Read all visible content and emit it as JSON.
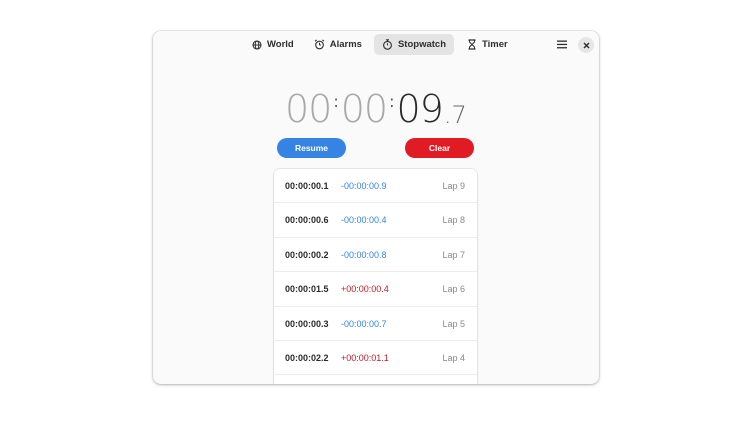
{
  "tabs": [
    {
      "label": "World",
      "icon": "globe-icon",
      "active": false
    },
    {
      "label": "Alarms",
      "icon": "alarm-clock-icon",
      "active": false
    },
    {
      "label": "Stopwatch",
      "icon": "stopwatch-icon",
      "active": true
    },
    {
      "label": "Timer",
      "icon": "hourglass-icon",
      "active": false
    }
  ],
  "header": {
    "menu_icon": "hamburger-menu-icon",
    "close_icon": "close-icon"
  },
  "clock": {
    "hours": "00",
    "sep1": ":",
    "minutes": "00",
    "sep2": ":",
    "seconds": "09",
    "fraction": ".7"
  },
  "buttons": {
    "resume_label": "Resume",
    "clear_label": "Clear"
  },
  "laps": [
    {
      "time": "00:00:00.1",
      "delta": "-00:00:00.9",
      "sign": "neg",
      "name": "Lap 9"
    },
    {
      "time": "00:00:00.6",
      "delta": "-00:00:00.4",
      "sign": "neg",
      "name": "Lap 8"
    },
    {
      "time": "00:00:00.2",
      "delta": "-00:00:00.8",
      "sign": "neg",
      "name": "Lap 7"
    },
    {
      "time": "00:00:01.5",
      "delta": "+00:00:00.4",
      "sign": "pos",
      "name": "Lap 6"
    },
    {
      "time": "00:00:00.3",
      "delta": "-00:00:00.7",
      "sign": "neg",
      "name": "Lap 5"
    },
    {
      "time": "00:00:02.2",
      "delta": "+00:00:01.1",
      "sign": "pos",
      "name": "Lap 4"
    }
  ],
  "colors": {
    "accent_blue": "#3584e4",
    "destructive_red": "#e01b24",
    "positive_delta": "#c01c28",
    "negative_delta": "#3584e4"
  }
}
